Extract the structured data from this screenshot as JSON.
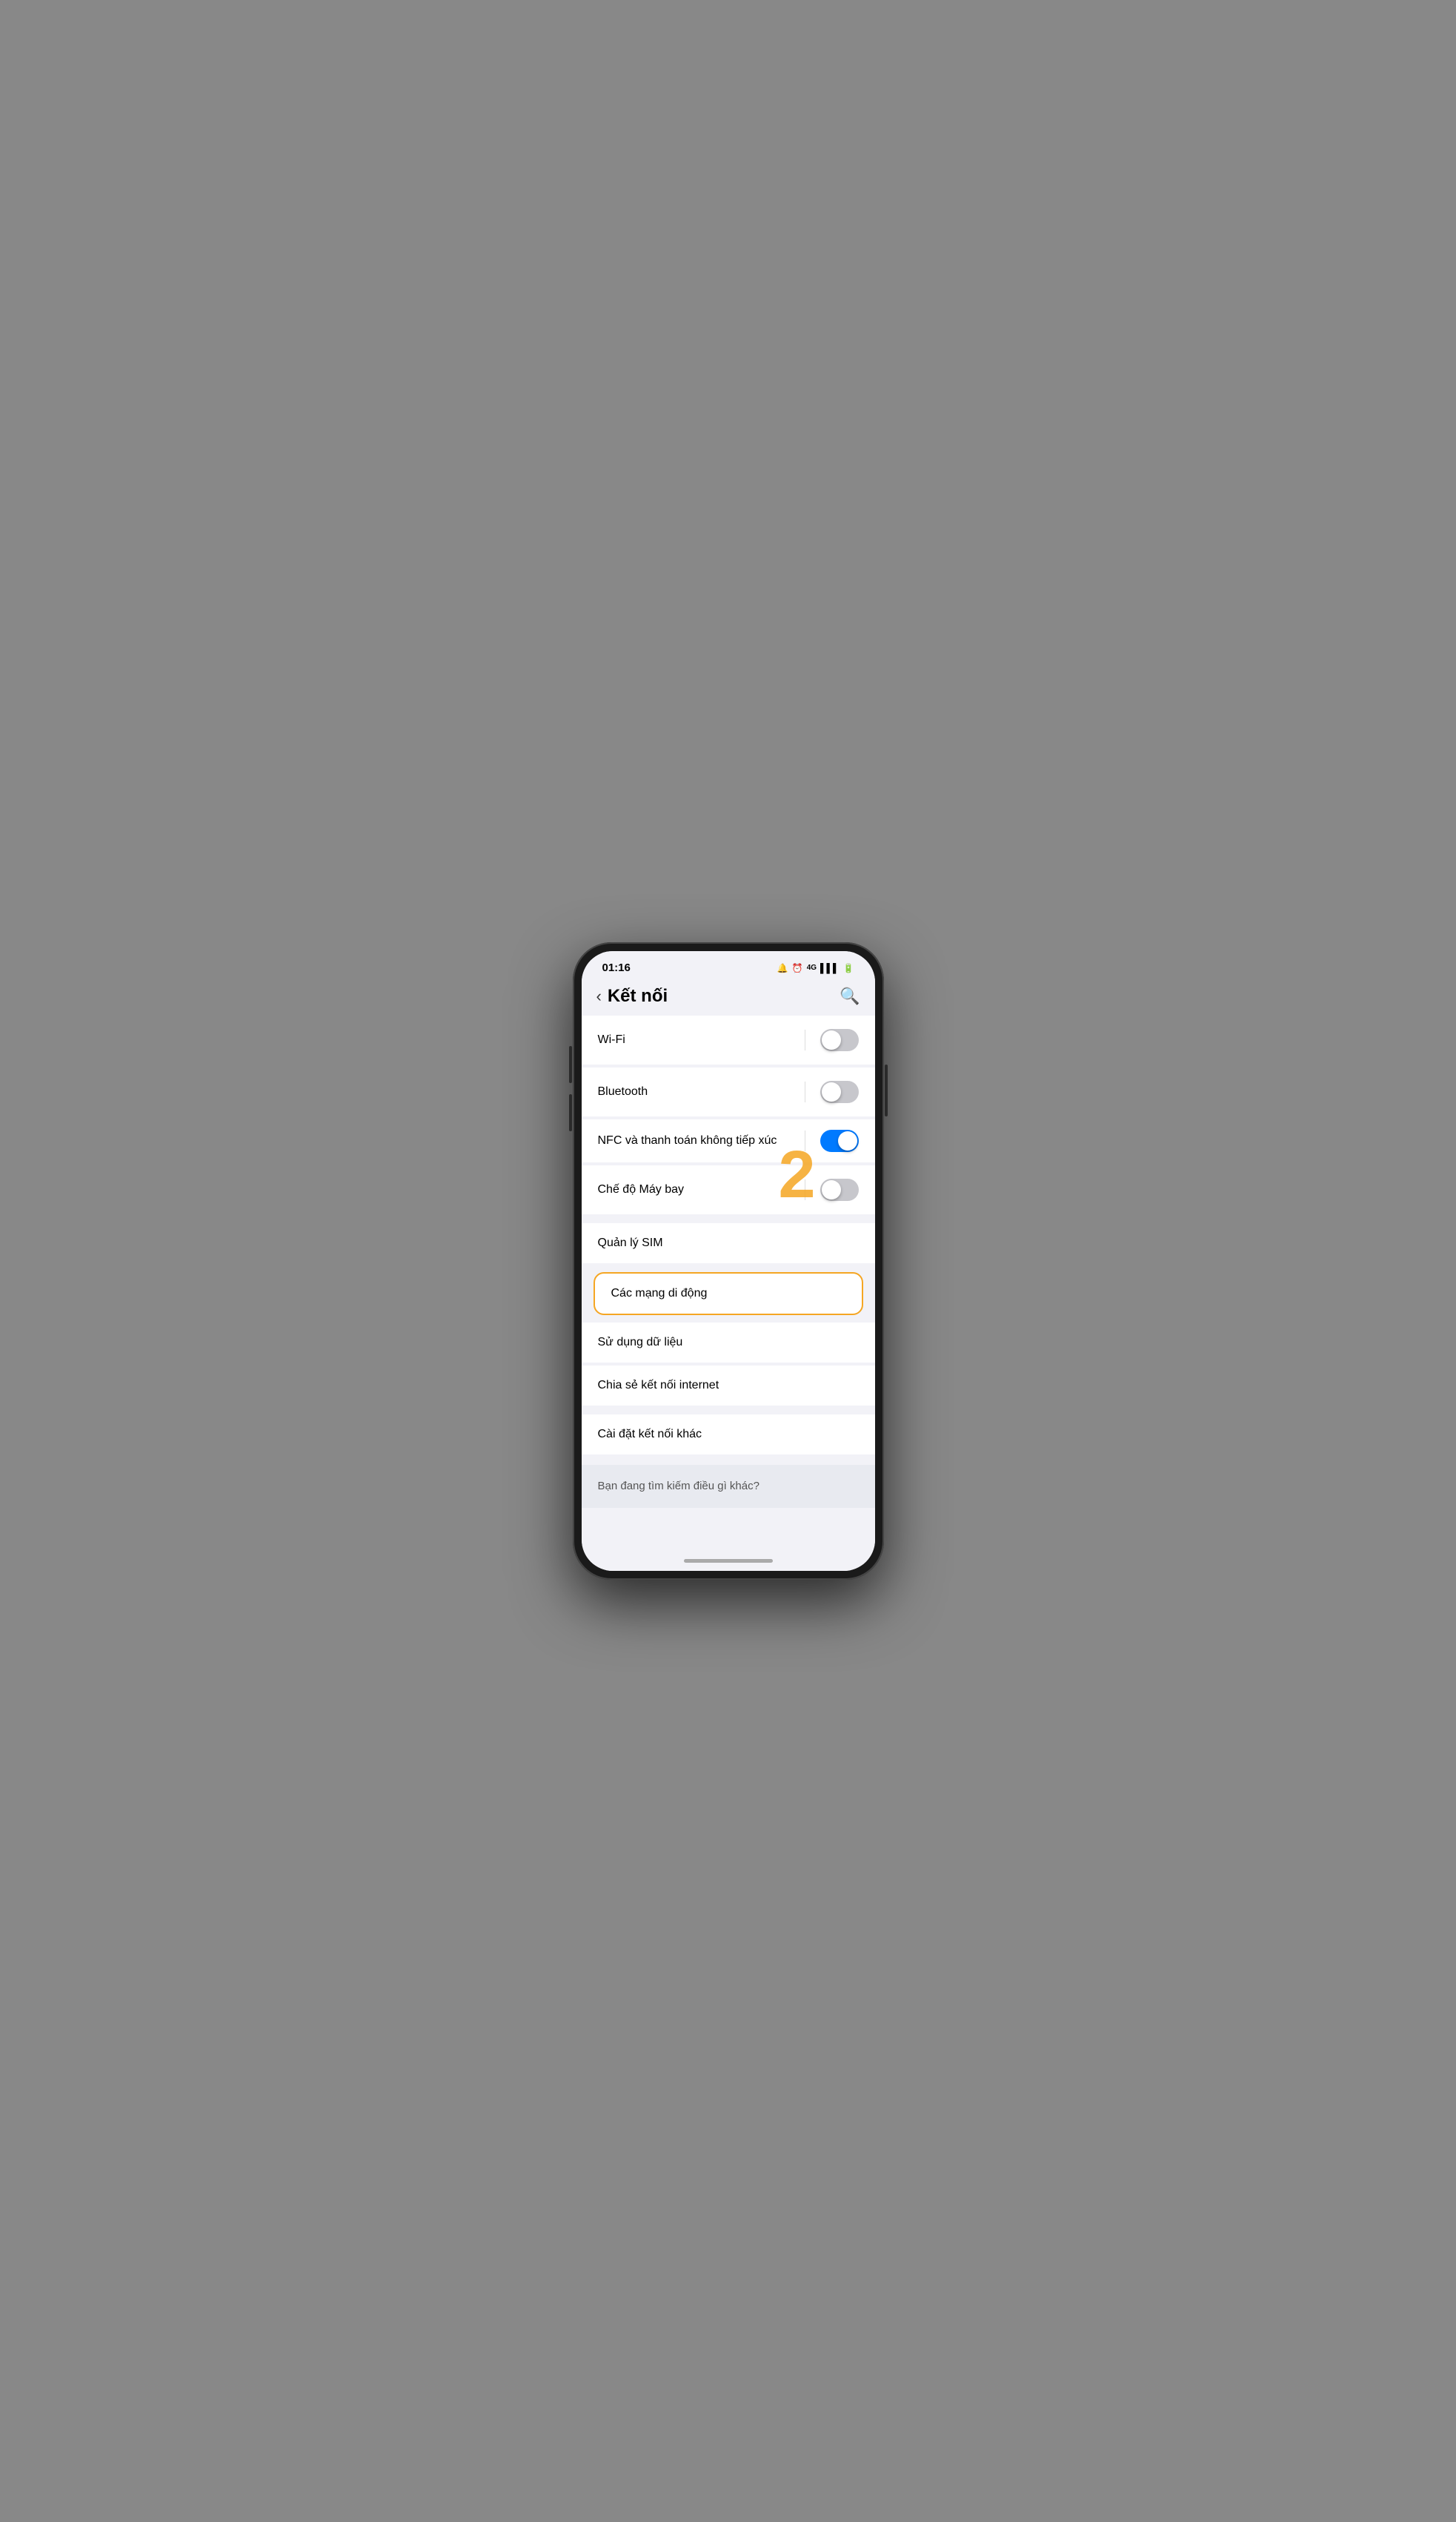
{
  "statusBar": {
    "time": "01:16",
    "icons": [
      "📋",
      "🔔",
      "4G",
      "📶",
      "🔋"
    ]
  },
  "header": {
    "backLabel": "‹",
    "title": "Kết nối",
    "searchIcon": "🔍"
  },
  "settingsItems": [
    {
      "id": "wifi",
      "label": "Wi-Fi",
      "hasToggle": true,
      "toggleState": "off",
      "hasDivider": true
    },
    {
      "id": "bluetooth",
      "label": "Bluetooth",
      "hasToggle": true,
      "toggleState": "off",
      "hasDivider": true
    },
    {
      "id": "nfc",
      "label": "NFC và thanh toán không tiếp xúc",
      "hasToggle": true,
      "toggleState": "on",
      "hasDivider": true,
      "multiline": true
    },
    {
      "id": "airplane",
      "label": "Chế độ Máy bay",
      "hasToggle": true,
      "toggleState": "off",
      "hasDivider": true
    }
  ],
  "listItems": [
    {
      "id": "sim",
      "label": "Quản lý SIM",
      "hasArrow": false
    },
    {
      "id": "mobile-networks",
      "label": "Các mạng di động",
      "highlighted": true
    },
    {
      "id": "data-usage",
      "label": "Sử dụng dữ liệu"
    },
    {
      "id": "hotspot",
      "label": "Chia sẻ kết nối internet"
    },
    {
      "id": "more-settings",
      "label": "Cài đặt kết nối khác"
    }
  ],
  "footer": {
    "text": "Bạn đang tìm kiếm điều gì khác?"
  },
  "annotation": {
    "number": "2"
  }
}
